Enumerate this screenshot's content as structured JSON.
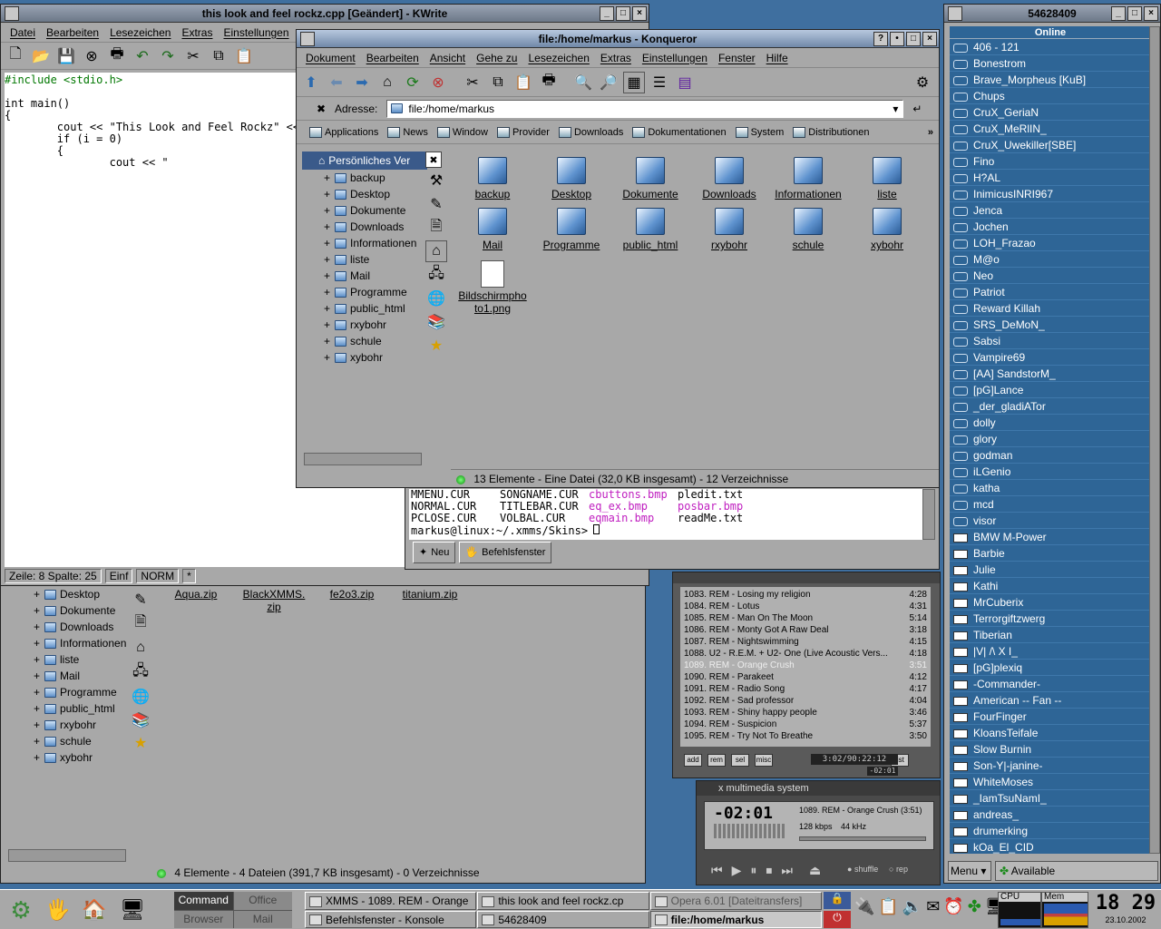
{
  "desktop_bg": "#3f6f9f",
  "kwrite": {
    "title": "this look and feel rockz.cpp [Geändert] - KWrite",
    "menu": [
      "Datei",
      "Bearbeiten",
      "Lesezeichen",
      "Extras",
      "Einstellungen"
    ],
    "code_lines": [
      {
        "text": "#include <stdio.h>",
        "color": "#007700"
      },
      {
        "text": "",
        "color": "#000"
      },
      {
        "text": "int main()",
        "color": "#000"
      },
      {
        "text": "{",
        "color": "#000"
      },
      {
        "text": "        cout << \"This Look and Feel Rockz\" <<",
        "color": "#000"
      },
      {
        "text": "        if (i = 0)",
        "color": "#000"
      },
      {
        "text": "        {",
        "color": "#000"
      },
      {
        "text": "                cout << \"",
        "color": "#000"
      }
    ],
    "status": [
      "Zeile: 8 Spalte: 25",
      "Einf",
      "NORM",
      "*"
    ]
  },
  "konqueror_main": {
    "title": "file:/home/markus - Konqueror",
    "menu": [
      "Dokument",
      "Bearbeiten",
      "Ansicht",
      "Gehe zu",
      "Lesezeichen",
      "Extras",
      "Einstellungen",
      "Fenster",
      "Hilfe"
    ],
    "address_label": "Adresse:",
    "address_value": "file:/home/markus",
    "bookmarks": [
      "Applications",
      "News",
      "Window",
      "Provider",
      "Downloads",
      "Dokumentationen",
      "System",
      "Distributionen"
    ],
    "tree_root": "Persönliches Ver",
    "tree": [
      "backup",
      "Desktop",
      "Dokumente",
      "Downloads",
      "Informationen",
      "liste",
      "Mail",
      "Programme",
      "public_html",
      "rxybohr",
      "schule",
      "xybohr"
    ],
    "icons": [
      "backup",
      "Desktop",
      "Dokumente",
      "Downloads",
      "Informationen",
      "liste",
      "Mail",
      "Programme",
      "public_html",
      "rxybohr",
      "schule",
      "xybohr"
    ],
    "file_label": "Bildschirmpho to1.png",
    "status": "13 Elemente - Eine Datei (32,0 KB insgesamt) - 12 Verzeichnisse"
  },
  "konsole": {
    "rows": [
      [
        "MMENU.CUR",
        "SONGNAME.CUR",
        "cbuttons.bmp",
        "pledit.txt"
      ],
      [
        "NORMAL.CUR",
        "TITLEBAR.CUR",
        "eq_ex.bmp",
        "posbar.bmp"
      ],
      [
        "PCLOSE.CUR",
        "VOLBAL.CUR",
        "eqmain.bmp",
        "readMe.txt"
      ]
    ],
    "prompt": "markus@linux:~/.xmms/Skins>",
    "tabs": [
      "Neu",
      "Befehlsfenster"
    ]
  },
  "konqueror_back": {
    "tree": [
      "Desktop",
      "Dokumente",
      "Downloads",
      "Informationen",
      "liste",
      "Mail",
      "Programme",
      "public_html",
      "rxybohr",
      "schule",
      "xybohr"
    ],
    "files": [
      "Aqua.zip",
      "BlackXMMS. zip",
      "fe2o3.zip",
      "titanium.zip"
    ],
    "status": "4 Elemente - 4 Dateien (391,7 KB insgesamt) - 0 Verzeichnisse"
  },
  "playlist": {
    "items": [
      {
        "n": "1083. REM - Losing my religion",
        "t": "4:28"
      },
      {
        "n": "1084. REM - Lotus",
        "t": "4:31"
      },
      {
        "n": "1085. REM - Man On The Moon",
        "t": "5:14"
      },
      {
        "n": "1086. REM - Monty Got A Raw Deal",
        "t": "3:18"
      },
      {
        "n": "1087. REM - Nightswimming",
        "t": "4:15"
      },
      {
        "n": "1088. U2 - R.E.M. + U2- One (Live Acoustic Vers...",
        "t": "4:18"
      },
      {
        "n": "1089. REM - Orange Crush",
        "t": "3:51"
      },
      {
        "n": "1090. REM - Parakeet",
        "t": "4:12"
      },
      {
        "n": "1091. REM - Radio Song",
        "t": "4:17"
      },
      {
        "n": "1092. REM - Sad professor",
        "t": "4:04"
      },
      {
        "n": "1093. REM - Shiny happy people",
        "t": "3:46"
      },
      {
        "n": "1094. REM - Suspicion",
        "t": "5:37"
      },
      {
        "n": "1095. REM - Try Not To Breathe",
        "t": "3:50"
      }
    ],
    "active_index": 6,
    "buttons": [
      "add",
      "rem",
      "sel",
      "misc",
      "list"
    ],
    "time": "3:02/90:22:12",
    "sub_time": "-02:01"
  },
  "xmms": {
    "title": "x multimedia system",
    "time": "-02:01",
    "song": "1089. REM - Orange Crush (3:51)",
    "kbps": "128 kbps",
    "khz": "44 kHz",
    "shuffle": "shuffle",
    "rep": "rep"
  },
  "licq": {
    "title": "54628409",
    "online_header": "Online",
    "online": [
      "406 - 121",
      "Bonestrom",
      "Brave_Morpheus [KuB]",
      "Chups",
      "CruX_GeriaN",
      "CruX_MeRlIN_",
      "CruX_Uwekiller[SBE]",
      "Fino",
      "H?AL",
      "InimicusINRI967",
      "Jenca",
      "Jochen",
      "LOH_Frazao",
      "M@o",
      "Neo",
      "Patriot",
      "Reward Killah",
      "SRS_DeMoN_",
      "Sabsi",
      "Vampire69",
      "[AA] SandstorM_",
      "[pG]Lance",
      "_der_gladiATor",
      "dolly",
      "glory",
      "godman",
      "iLGenio",
      "katha",
      "mcd",
      "visor"
    ],
    "away": [
      "BMW M-Power",
      "Barbie",
      "Julie",
      "Kathi",
      "MrCuberix",
      "Terrorgiftzwerg",
      "Tiberian",
      "|V| /\\ X I_"
    ],
    "na": [
      "[pG]plexiq",
      "-Commander-",
      "American -- Fan --",
      "FourFinger",
      "KloansTeifale",
      "Slow Burnin",
      "Son-Y|-janine-",
      "WhiteMoses",
      "_IamTsuNamI_",
      "andreas_",
      "drumerking",
      "kOa_El_CID"
    ],
    "menu_label": "Menu",
    "status_label": "Available"
  },
  "taskbar": {
    "pager": [
      "Command",
      "Office",
      "Browser",
      "Mail"
    ],
    "tasks": [
      {
        "label": "XMMS - 1089. REM - Orange",
        "active": false
      },
      {
        "label": "this look and feel rockz.cp",
        "active": false
      },
      {
        "label": "Opera 6.01 [Dateitransfers]",
        "active": false
      },
      {
        "label": "Befehlsfenster - Konsole",
        "active": false
      },
      {
        "label": "54628409",
        "active": false
      },
      {
        "label": "file:/home/markus",
        "active": true
      }
    ],
    "cpu_label": "CPU",
    "mem_label": "Mem",
    "clock": "18 29",
    "date": "23.10.2002"
  }
}
